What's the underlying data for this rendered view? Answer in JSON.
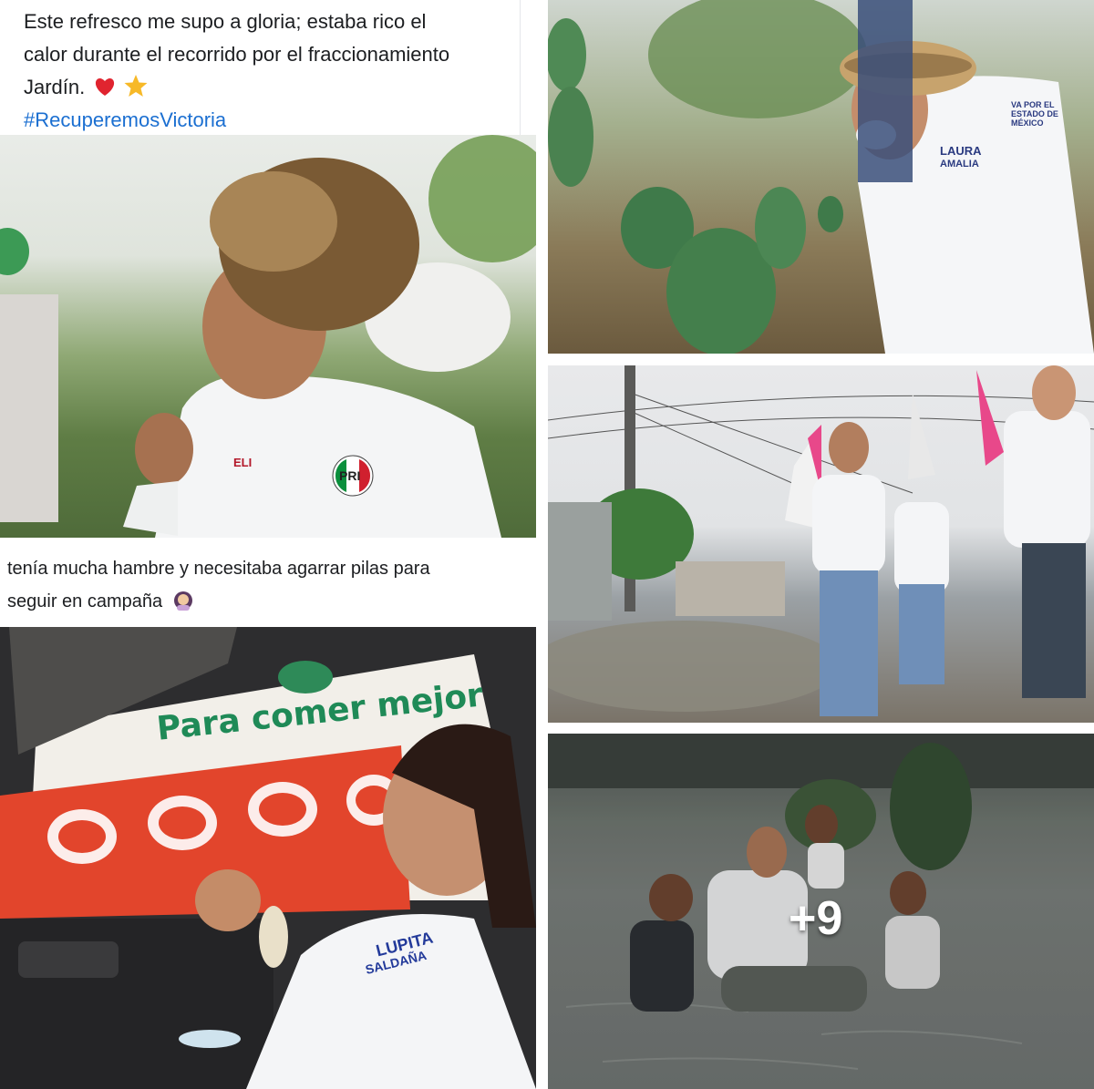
{
  "post1": {
    "caption_line1": "Este refresco me supo a gloria; estaba rico el",
    "caption_line2": "calor durante el recorrido por el fraccionamiento",
    "caption_line3": "Jardín.",
    "emoji_heart": "red-heart-emoji",
    "emoji_star": "star-emoji",
    "hashtag": "#RecuperemosVictoria",
    "shirt_name_badge": "ELI",
    "party_logo": "PRI"
  },
  "post2": {
    "caption_line1": "tenía mucha hambre y necesitaba agarrar pilas para",
    "caption_line2": "seguir en campaña",
    "emoji_person": "person-gesturing-emoji",
    "mural_text": "Para comer mejor",
    "shirt_name_badge_1": "LUPITA",
    "shirt_name_badge_2": "SALDAÑA"
  },
  "photo_top_right": {
    "shirt_badge_1": "LAURA",
    "shirt_badge_2": "AMALIA",
    "shirt_logo": "VA POR EL ESTADO DE MÉXICO"
  },
  "photo_bottom_right": {
    "more_count": "+9"
  },
  "colors": {
    "hashtag_blue": "#1b6fd1",
    "pri_red": "#d0202e",
    "pri_green": "#0a8f3c",
    "mural_green": "#1f8a57",
    "mural_red": "#e2452c"
  }
}
